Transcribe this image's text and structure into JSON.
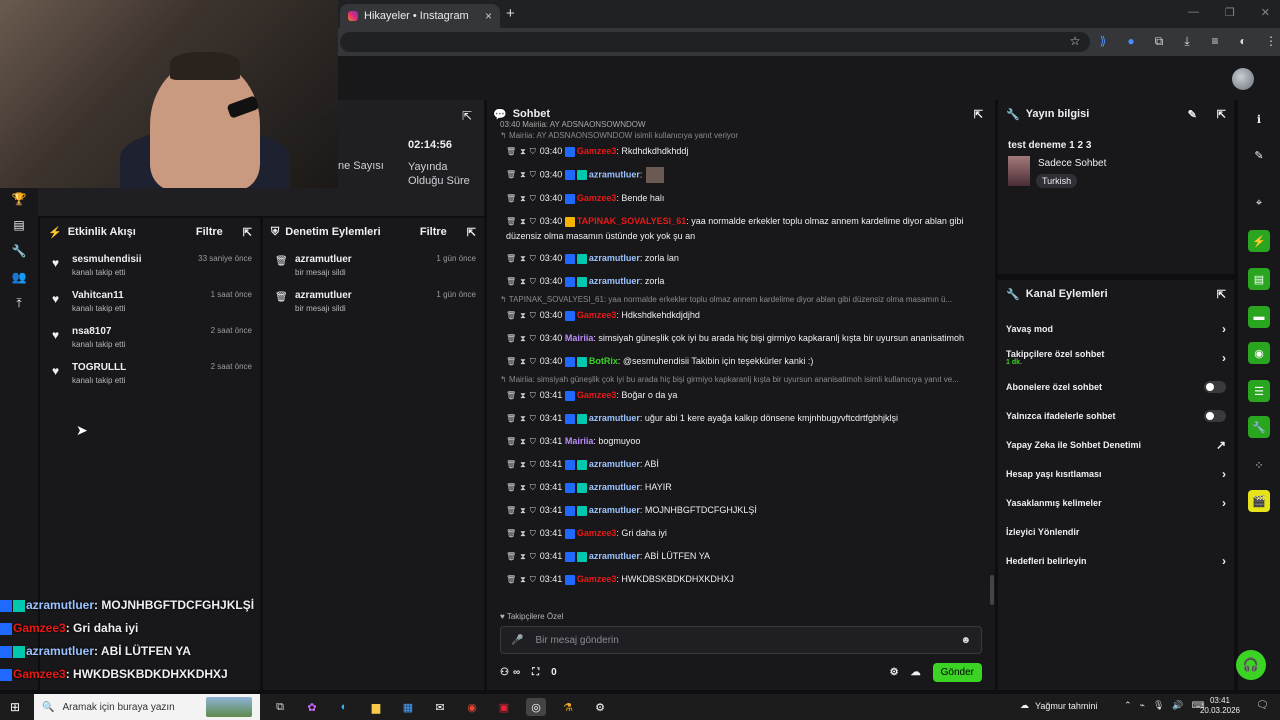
{
  "browser": {
    "tab_title": "Hikayeler • Instagram",
    "tab_close": "×",
    "new_tab": "+",
    "window_controls": [
      "—",
      "❐",
      "✕"
    ],
    "toolbar_icons": [
      "star-icon",
      "extension-icon",
      "shield-icon",
      "puzzle-icon",
      "download-icon",
      "playlist-icon",
      "profile-icon",
      "menu-icon"
    ]
  },
  "stats": {
    "uptime": "02:14:56",
    "uptime_label": "Yayında Olduğu Süre",
    "viewers_label": "ne Sayısı"
  },
  "activity": {
    "title": "Etkinlik Akışı",
    "filter": "Filtre",
    "items": [
      {
        "name": "sesmuhendisii",
        "sub": "kanalı takip etti",
        "time": "33 saniye önce"
      },
      {
        "name": "Vahitcan11",
        "sub": "kanalı takip etti",
        "time": "1 saat önce"
      },
      {
        "name": "nsa8107",
        "sub": "kanalı takip etti",
        "time": "2 saat önce"
      },
      {
        "name": "TOGRULLL",
        "sub": "kanalı takip etti",
        "time": "2 saat önce"
      }
    ]
  },
  "moderation": {
    "title": "Denetim Eylemleri",
    "filter": "Filtre",
    "items": [
      {
        "name": "azramutluer",
        "sub": "bir mesajı sildi",
        "time": "1 gün önce"
      },
      {
        "name": "azramutluer",
        "sub": "bir mesajı sildi",
        "time": "1 gün önce"
      }
    ]
  },
  "chat": {
    "title": "Sohbet",
    "top_partial": "03:40 Mairiia: AY ADSNAONSOWNDOW",
    "lines": [
      {
        "reply": "Mairiia: AY ADSNAONSOWNDOW isimli kullanıcıya yanıt veriyor"
      },
      {
        "time": "03:40",
        "badges": [
          "b"
        ],
        "name": "Gamzee3",
        "color": "#e91916",
        "text": ": Rkdhdkdhdkhddj"
      },
      {
        "time": "03:40",
        "badges": [
          "b",
          "g"
        ],
        "name": "azramutluer",
        "color": "#9bc3ff",
        "text": ":",
        "emote": true
      },
      {
        "time": "03:40",
        "badges": [
          "b"
        ],
        "name": "Gamzee3",
        "color": "#e91916",
        "text": ": Bende halı"
      },
      {
        "time": "03:40",
        "badges": [
          "y"
        ],
        "name": "TAPINAK_SOVALYESI_61",
        "color": "#e91916",
        "text": ": yaa normalde erkekler toplu olmaz annem kardelime diyor ablan gibi düzensiz olma masamın üstünde yok yok şu an"
      },
      {
        "time": "03:40",
        "badges": [
          "b",
          "g"
        ],
        "name": "azramutluer",
        "color": "#9bc3ff",
        "text": ": zorla lan"
      },
      {
        "time": "03:40",
        "badges": [
          "b",
          "g"
        ],
        "name": "azramutluer",
        "color": "#9bc3ff",
        "text": ": zorla"
      },
      {
        "reply": "TAPINAK_SOVALYESI_61: yaa normalde erkekler toplu olmaz annem kardelime diyor ablan gibi düzensiz olma masamın ü..."
      },
      {
        "time": "03:40",
        "badges": [
          "b"
        ],
        "name": "Gamzee3",
        "color": "#e91916",
        "text": ": Hdkshdkehdkdjdjhd"
      },
      {
        "time": "03:40",
        "badges": [],
        "name": "Mairiia",
        "color": "#b98cf5",
        "text": ": simsiyah güneşlik çok iyi bu arada hiç bişi girmiyo kapkaranlj kışta bir uyursun ananisatimoh"
      },
      {
        "time": "03:40",
        "badges": [
          "b",
          "g"
        ],
        "name": "BotRix",
        "color": "#3bd425",
        "text": ": @sesmuhendisii Takibin için teşekkürler kanki :)"
      },
      {
        "reply": "Mairiia: simsiyah güneşlik çok iyi bu arada hiç bişi girmiyo kapkaranlj kışta bir uyursun ananisatimoh isimli kullanıcıya yanıt ve..."
      },
      {
        "time": "03:41",
        "badges": [
          "b"
        ],
        "name": "Gamzee3",
        "color": "#e91916",
        "text": ": Boğar o da ya"
      },
      {
        "time": "03:41",
        "badges": [
          "b",
          "g"
        ],
        "name": "azramutluer",
        "color": "#9bc3ff",
        "text": ": uğur abi 1 kere ayağa kalkıp dönsene kmjnhbugyvftcdrtfgbhjklşi"
      },
      {
        "time": "03:41",
        "badges": [],
        "name": "Mairiia",
        "color": "#b98cf5",
        "text": ": bogmuyoo"
      },
      {
        "time": "03:41",
        "badges": [
          "b",
          "g"
        ],
        "name": "azramutluer",
        "color": "#9bc3ff",
        "text": ": ABİ"
      },
      {
        "time": "03:41",
        "badges": [
          "b",
          "g"
        ],
        "name": "azramutluer",
        "color": "#9bc3ff",
        "text": ": HAYIR"
      },
      {
        "time": "03:41",
        "badges": [
          "b",
          "g"
        ],
        "name": "azramutluer",
        "color": "#9bc3ff",
        "text": ": MOJNHBGFTDCFGHJKLŞİ"
      },
      {
        "time": "03:41",
        "badges": [
          "b"
        ],
        "name": "Gamzee3",
        "color": "#e91916",
        "text": ": Gri daha iyi"
      },
      {
        "time": "03:41",
        "badges": [
          "b",
          "g"
        ],
        "name": "azramutluer",
        "color": "#9bc3ff",
        "text": ": ABİ LÜTFEN YA"
      },
      {
        "time": "03:41",
        "badges": [
          "b"
        ],
        "name": "Gamzee3",
        "color": "#e91916",
        "text": ": HWKDBSKBDKDHXKDHXJ"
      }
    ],
    "followers_only": "Takipçilere Özel",
    "placeholder": "Bir mesaj gönderin",
    "infinity": "∞",
    "points": "0",
    "send": "Gönder"
  },
  "info": {
    "title": "Yayın bilgisi",
    "stream_title": "test deneme 1 2 3",
    "category": "Sadece Sohbet",
    "tag": "Turkish"
  },
  "actions": {
    "title": "Kanal Eylemleri",
    "items": [
      {
        "label": "Yavaş mod",
        "ctl": "›"
      },
      {
        "label": "Takipçilere özel sohbet",
        "sub": "1 dk.",
        "ctl": "›"
      },
      {
        "label": "Abonelere özel sohbet",
        "ctl": "toggle"
      },
      {
        "label": "Yalnızca ifadelerle sohbet",
        "ctl": "toggle"
      },
      {
        "label": "Yapay Zeka ile Sohbet Denetimi",
        "ctl": "↗"
      },
      {
        "label": "Hesap yaşı kısıtlaması",
        "ctl": "›"
      },
      {
        "label": "Yasaklanmış kelimeler",
        "ctl": "›"
      },
      {
        "label": "İzleyici Yönlendir",
        "ctl": ""
      },
      {
        "label": "Hedefleri belirleyin",
        "ctl": "›"
      }
    ]
  },
  "overlay": [
    {
      "badges": [
        "b",
        "g"
      ],
      "name": "azramutluer",
      "color": "#9bc3ff",
      "text": ": MOJNHBGFTDCFGHJKLŞİ"
    },
    {
      "badges": [
        "b"
      ],
      "name": "Gamzee3",
      "color": "#e91916",
      "text": ": Gri daha iyi"
    },
    {
      "badges": [
        "b",
        "g"
      ],
      "name": "azramutluer",
      "color": "#9bc3ff",
      "text": ": ABİ LÜTFEN YA"
    },
    {
      "badges": [
        "b"
      ],
      "name": "Gamzee3",
      "color": "#e91916",
      "text": ": HWKDBSKBDKDHXKDHXJ"
    }
  ],
  "taskbar": {
    "search_placeholder": "Aramak için buraya yazın",
    "weather": "Yağmur tahmini",
    "time": "03:41",
    "date": "20.03.2026"
  }
}
